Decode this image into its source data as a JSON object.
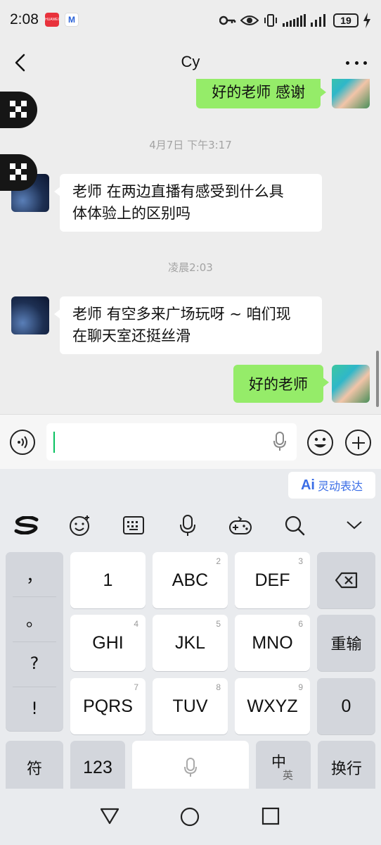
{
  "status_bar": {
    "time": "2:08",
    "notifications": [
      "huawei-app-icon",
      "gmail-m-icon"
    ],
    "battery": "19",
    "icons": [
      "key-icon",
      "eye-icon",
      "vibrate-icon",
      "signal-icon",
      "signal-icon",
      "charging-icon"
    ]
  },
  "header": {
    "title": "Cy"
  },
  "messages": [
    {
      "side": "right",
      "text": "好的老师 感谢"
    },
    {
      "type": "timestamp",
      "text": "4月7日 下午3:17"
    },
    {
      "side": "left",
      "text": "老师 在两边直播有感受到什么具体体验上的区别吗"
    },
    {
      "type": "timestamp",
      "text": "凌晨2:03"
    },
    {
      "side": "left",
      "text": "老师 有空多来广场玩呀 ~ 咱们现在聊天室还挺丝滑"
    },
    {
      "side": "right",
      "text": "好的老师"
    }
  ],
  "msg_lines": {
    "m2_line1": "老师 在两边直播有感受到什么具",
    "m2_line2": "体体验上的区别吗",
    "m4_line1": "老师 有空多来广场玩呀 ~ 咱们现",
    "m4_line2": "在聊天室还挺丝滑"
  },
  "input": {
    "value": "",
    "placeholder": ""
  },
  "keyboard": {
    "ai_chip": {
      "mark": "Ai",
      "label": "灵动表达"
    },
    "toolbar": [
      "sogou-logo-icon",
      "emoji-face-icon",
      "keyboard-icon",
      "microphone-icon",
      "gamepad-icon",
      "search-icon",
      "chevron-down-icon"
    ],
    "punctuation": [
      "，",
      "。",
      "?",
      "!"
    ],
    "keys": {
      "k1": "1",
      "k2": "ABC",
      "k2n": "2",
      "k3": "DEF",
      "k3n": "3",
      "k4": "GHI",
      "k4n": "4",
      "k5": "JKL",
      "k5n": "5",
      "k6": "MNO",
      "k6n": "6",
      "k7": "PQRS",
      "k7n": "7",
      "k8": "TUV",
      "k8n": "8",
      "k9": "WXYZ",
      "k9n": "9",
      "k0": "0",
      "reenter": "重输",
      "symbols": "符",
      "numbers": "123",
      "zh": "中",
      "en": "英",
      "newline": "换行"
    }
  },
  "navbar": [
    "back-triangle-icon",
    "home-circle-icon",
    "recents-square-icon"
  ],
  "colors": {
    "bubble_mine": "#95ec69",
    "bubble_other": "#ffffff",
    "chat_bg": "#ededed",
    "caret": "#07c160",
    "ai_accent": "#3a6de6"
  }
}
